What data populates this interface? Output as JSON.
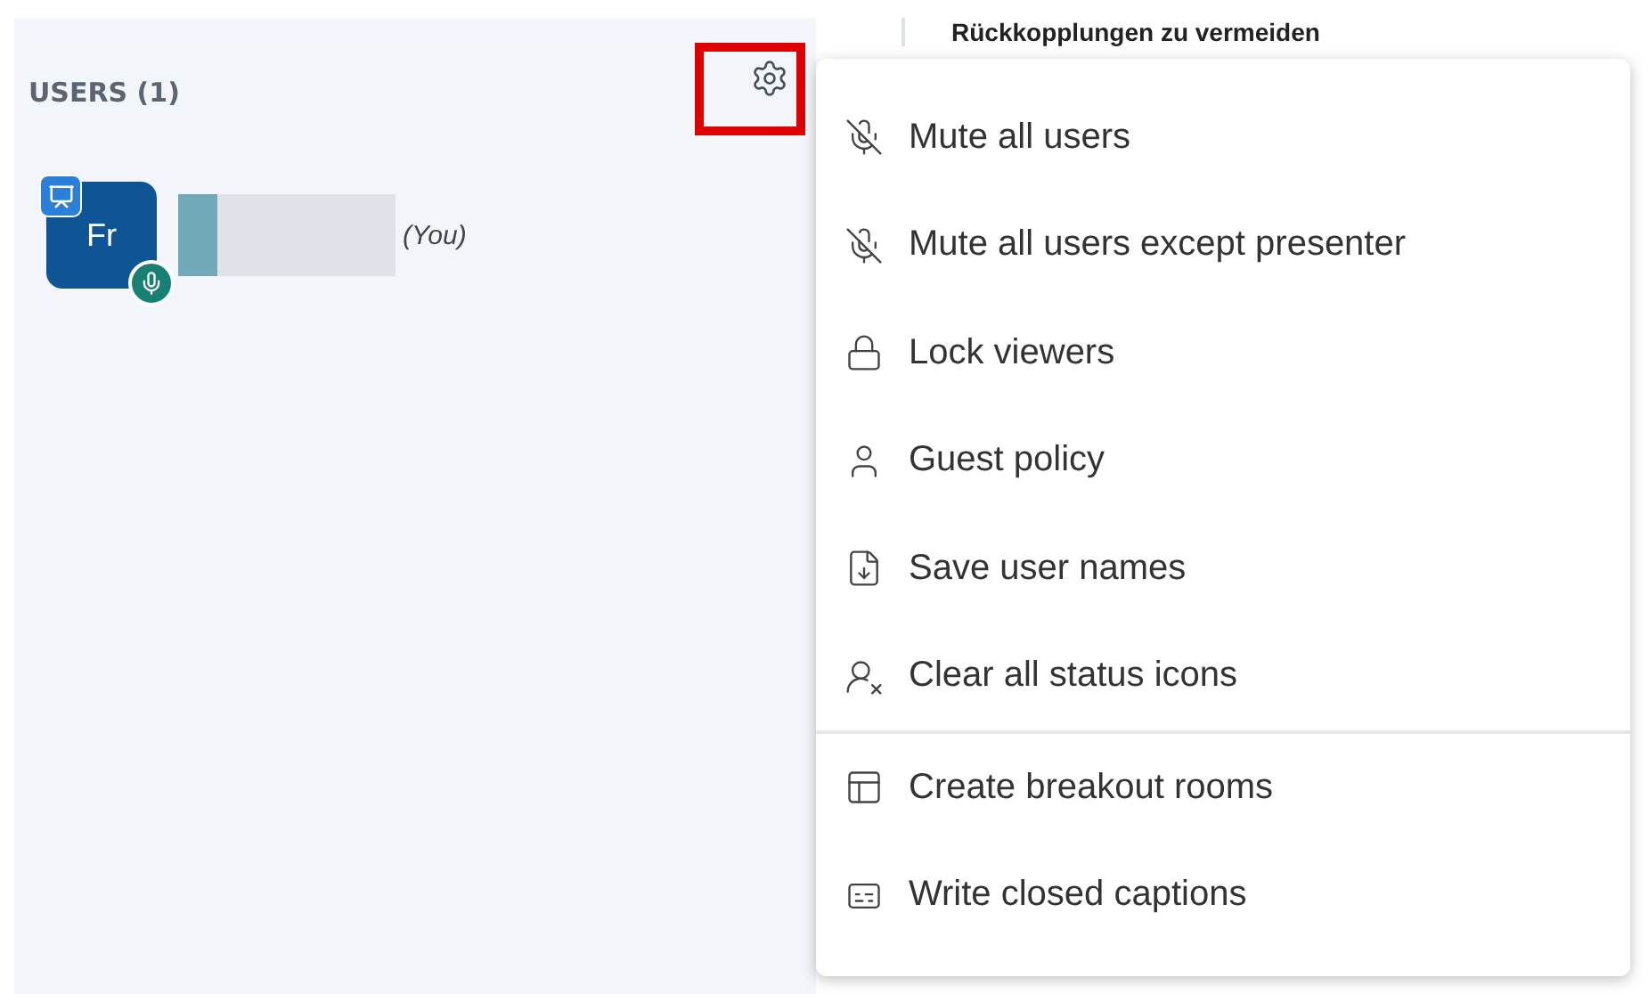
{
  "background_heading": "Rückkopplungen zu vermeiden",
  "users_panel": {
    "title": "USERS (1)",
    "settings_button": {
      "highlighted": true
    },
    "users": [
      {
        "initials": "Fr",
        "presenter": true,
        "mic": true,
        "you_label": "(You)"
      }
    ]
  },
  "settings_menu": {
    "sections": [
      [
        {
          "kind": "mic-off",
          "label": "Mute all users"
        },
        {
          "kind": "mic-off",
          "label": "Mute all users except presenter"
        },
        {
          "kind": "lock",
          "label": "Lock viewers"
        },
        {
          "kind": "user",
          "label": "Guest policy"
        },
        {
          "kind": "file-down",
          "label": "Save user names"
        },
        {
          "kind": "user-clear",
          "label": "Clear all status icons"
        }
      ],
      [
        {
          "kind": "rooms",
          "label": "Create breakout rooms"
        },
        {
          "kind": "cc",
          "label": "Write closed captions"
        }
      ]
    ]
  }
}
